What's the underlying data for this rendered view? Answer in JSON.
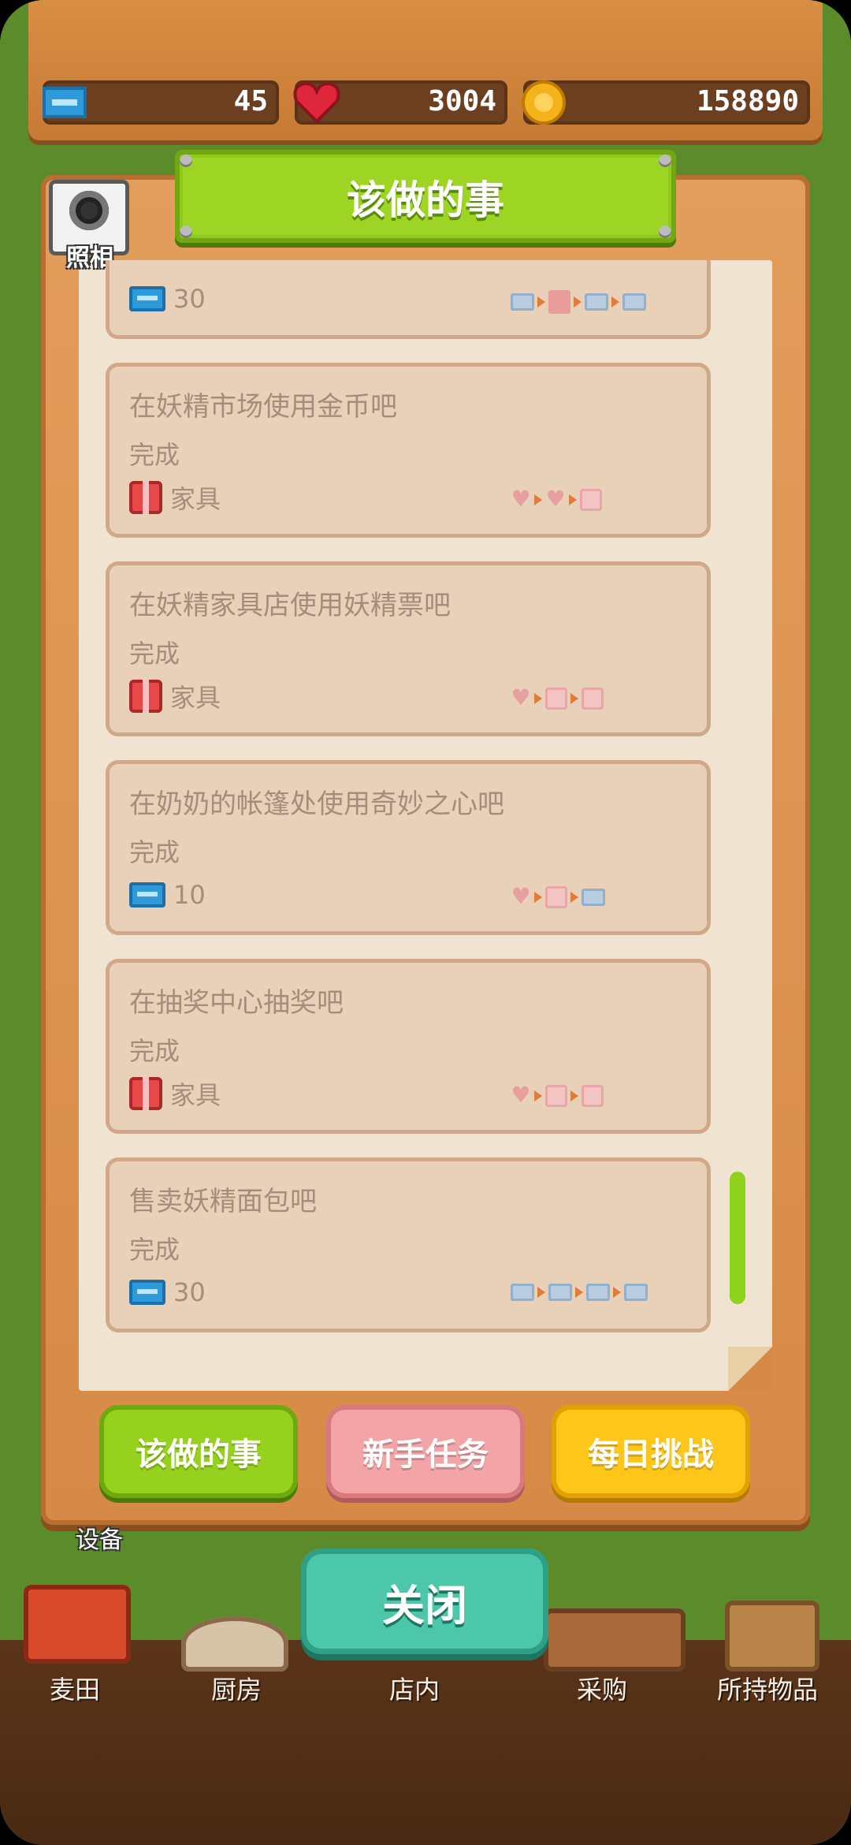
{
  "header": {
    "tickets": "45",
    "hearts": "3004",
    "coins": "158890"
  },
  "panel": {
    "title": "该做的事",
    "camera_label": "照相"
  },
  "tasks": [
    {
      "task": "",
      "status": "",
      "reward_icon": "ticket-icon",
      "reward": "30",
      "track": [
        "ticket",
        "book",
        "ticket",
        "ticket"
      ]
    },
    {
      "task": "在妖精市场使用金币吧",
      "status": "完成",
      "reward_icon": "gift-icon",
      "reward": "家具",
      "track": [
        "heart",
        "heart",
        "gift"
      ]
    },
    {
      "task": "在妖精家具店使用妖精票吧",
      "status": "完成",
      "reward_icon": "gift-icon",
      "reward": "家具",
      "track": [
        "heart",
        "gift",
        "gift"
      ]
    },
    {
      "task": "在奶奶的帐篷处使用奇妙之心吧",
      "status": "完成",
      "reward_icon": "ticket-icon",
      "reward": "10",
      "track": [
        "heart",
        "gift",
        "ticket"
      ]
    },
    {
      "task": "在抽奖中心抽奖吧",
      "status": "完成",
      "reward_icon": "gift-icon",
      "reward": "家具",
      "track": [
        "heart",
        "gift",
        "gift"
      ]
    },
    {
      "task": "售卖妖精面包吧",
      "status": "完成",
      "reward_icon": "ticket-icon",
      "reward": "30",
      "track": [
        "ticket",
        "ticket",
        "ticket",
        "ticket"
      ]
    }
  ],
  "tabs": {
    "todo": "该做的事",
    "newbie": "新手任务",
    "daily": "每日挑战"
  },
  "close_label": "关闭",
  "equip_label": "设备",
  "dock": {
    "field": "麦田",
    "kitchen": "厨房",
    "shop": "店内",
    "purchase": "采购",
    "items": "所持物品"
  },
  "colors": {
    "tab_green": "#95d11d",
    "tab_pink": "#f3a4a6",
    "tab_yellow": "#ffc61a",
    "close": "#4cc7a9"
  }
}
